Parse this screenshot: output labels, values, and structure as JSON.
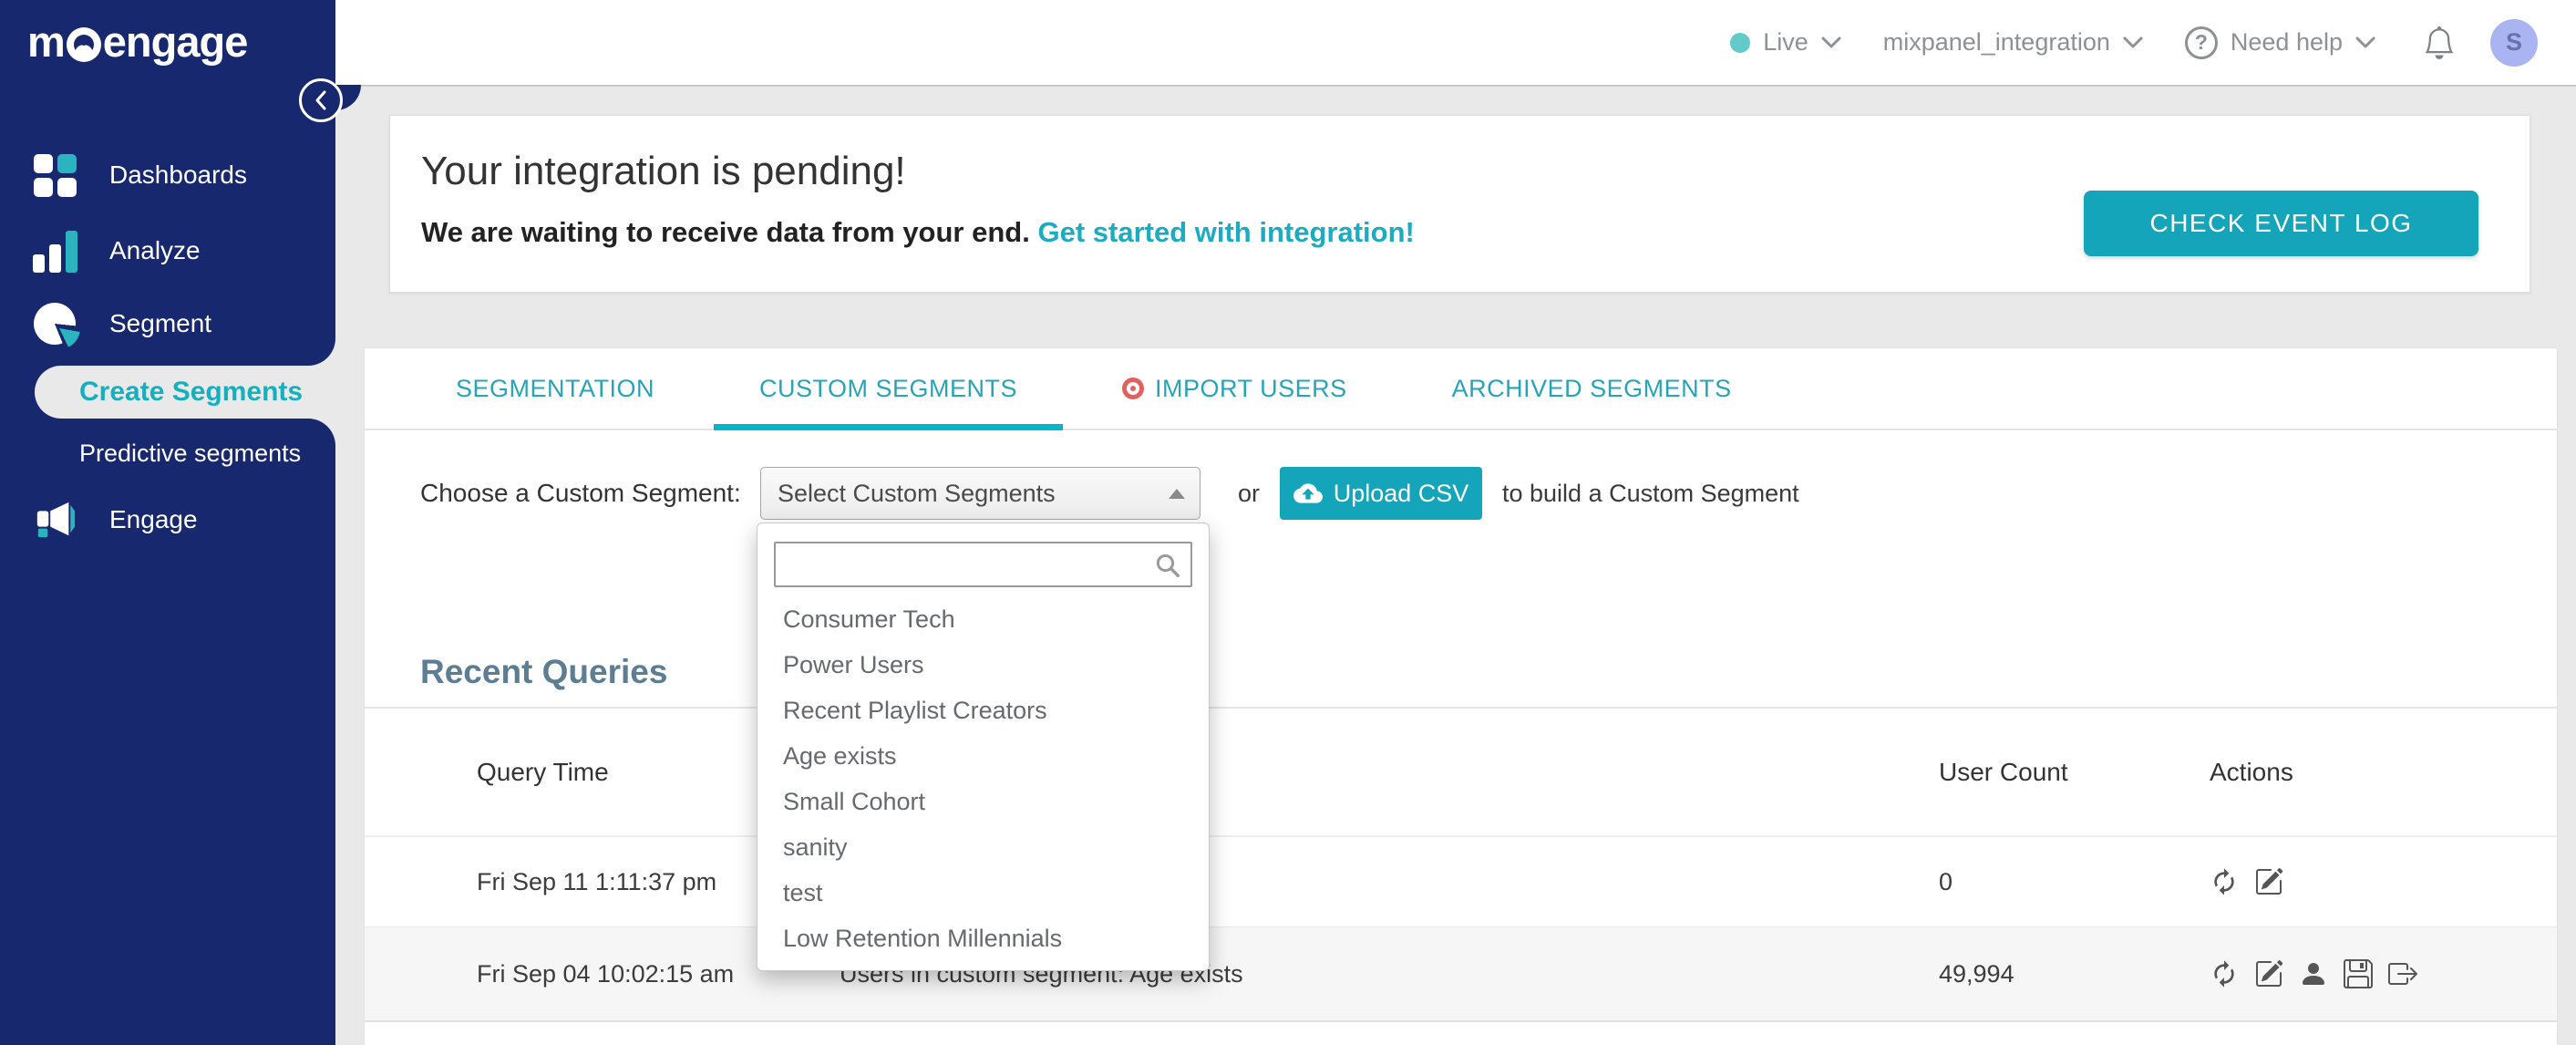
{
  "brand": {
    "logo_text_before_o": "m",
    "logo_text_after_o": "engage"
  },
  "topbar": {
    "env_label": "Live",
    "workspace": "mixpanel_integration",
    "help_label": "Need help",
    "avatar_initial": "S"
  },
  "sidebar": {
    "items": [
      {
        "label": "Dashboards",
        "icon": "grid-icon"
      },
      {
        "label": "Analyze",
        "icon": "bar-chart-icon"
      },
      {
        "label": "Segment",
        "icon": "pie-chart-icon"
      },
      {
        "label": "Create Segments",
        "active": true
      },
      {
        "label": "Predictive segments"
      },
      {
        "label": "Engage",
        "icon": "megaphone-icon"
      }
    ]
  },
  "banner": {
    "title": "Your integration is pending!",
    "subtitle": "We are waiting to receive data from your end.",
    "link_text": "Get started with integration!",
    "button_label": "CHECK EVENT LOG"
  },
  "tabs": [
    {
      "label": "SEGMENTATION",
      "active": false
    },
    {
      "label": "CUSTOM SEGMENTS",
      "active": true
    },
    {
      "label": "IMPORT USERS",
      "active": false,
      "icon": "record-dot-icon"
    },
    {
      "label": "ARCHIVED SEGMENTS",
      "active": false
    }
  ],
  "chooser": {
    "label": "Choose a Custom Segment:",
    "select_value": "Select Custom Segments",
    "or_text": "or",
    "upload_button_label": "Upload CSV",
    "upload_icon": "cloud-upload-icon",
    "suffix_text": "to build a Custom Segment",
    "dropdown": {
      "search_placeholder": "",
      "search_icon": "search-icon",
      "options": [
        "Consumer Tech",
        "Power Users",
        "Recent Playlist Creators",
        "Age exists",
        "Small Cohort",
        "sanity",
        "test",
        "Low Retention Millennials"
      ]
    }
  },
  "recent_queries": {
    "title": "Recent Queries",
    "columns": {
      "time": "Query Time",
      "count": "User Count",
      "actions": "Actions"
    },
    "rows": [
      {
        "time": "Fri Sep 11 1:11:37 pm",
        "query": "",
        "user_count": "0",
        "actions": [
          "refresh",
          "edit"
        ]
      },
      {
        "time": "Fri Sep 04 10:02:15 am",
        "query": "Users in custom segment: Age exists",
        "user_count": "49,994",
        "actions": [
          "refresh",
          "edit",
          "person",
          "save",
          "export"
        ]
      }
    ]
  },
  "colors": {
    "sidebar_navy": "#18286e",
    "accent_teal": "#14a5ba",
    "tab_underline": "#00b7ce",
    "link_teal": "#1cabc0",
    "heading_slate": "#5c7d92",
    "page_bg": "#e9e9e9",
    "import_users_red": "#e2605f",
    "avatar_bg": "#aab4f2",
    "live_dot": "#62cbc9"
  }
}
